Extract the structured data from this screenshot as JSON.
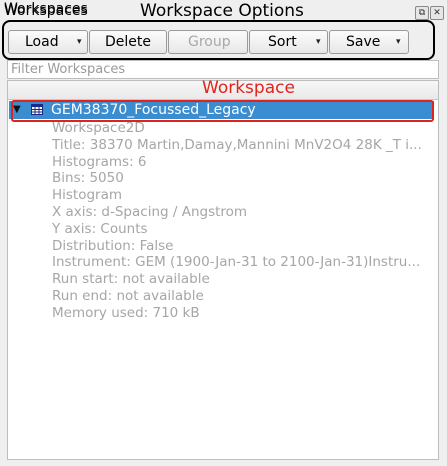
{
  "panel": {
    "title": "Workspaces",
    "float_glyph": "⧉",
    "close_glyph": "✕"
  },
  "annotations": {
    "options_label": "Workspace Options",
    "workspace_label": "Workspace",
    "color": "#e0241b"
  },
  "toolbar": {
    "load_label": "Load",
    "delete_label": "Delete",
    "group_label": "Group",
    "sort_label": "Sort",
    "save_label": "Save",
    "dropdown_glyph": "▾"
  },
  "filter": {
    "placeholder": "Filter Workspaces"
  },
  "tree": {
    "header": "Workspaces",
    "selection_color": "#3a8dd0",
    "workspace": {
      "name": "GEM38370_Focussed_Legacy",
      "expanded": true,
      "expand_glyph": "▼",
      "icon": "table-icon",
      "properties": [
        "Workspace2D",
        "Title: 38370 Martin,Damay,Mannini MnV2O4 28K _T i...",
        "Histograms: 6",
        "Bins: 5050",
        "Histogram",
        "X axis: d-Spacing / Angstrom",
        "Y axis: Counts",
        "Distribution: False",
        "Instrument: GEM (1900-Jan-31 to 2100-Jan-31)Instru...",
        "Run start: not available",
        "Run end:  not available",
        "Memory used: 710 kB"
      ]
    }
  }
}
